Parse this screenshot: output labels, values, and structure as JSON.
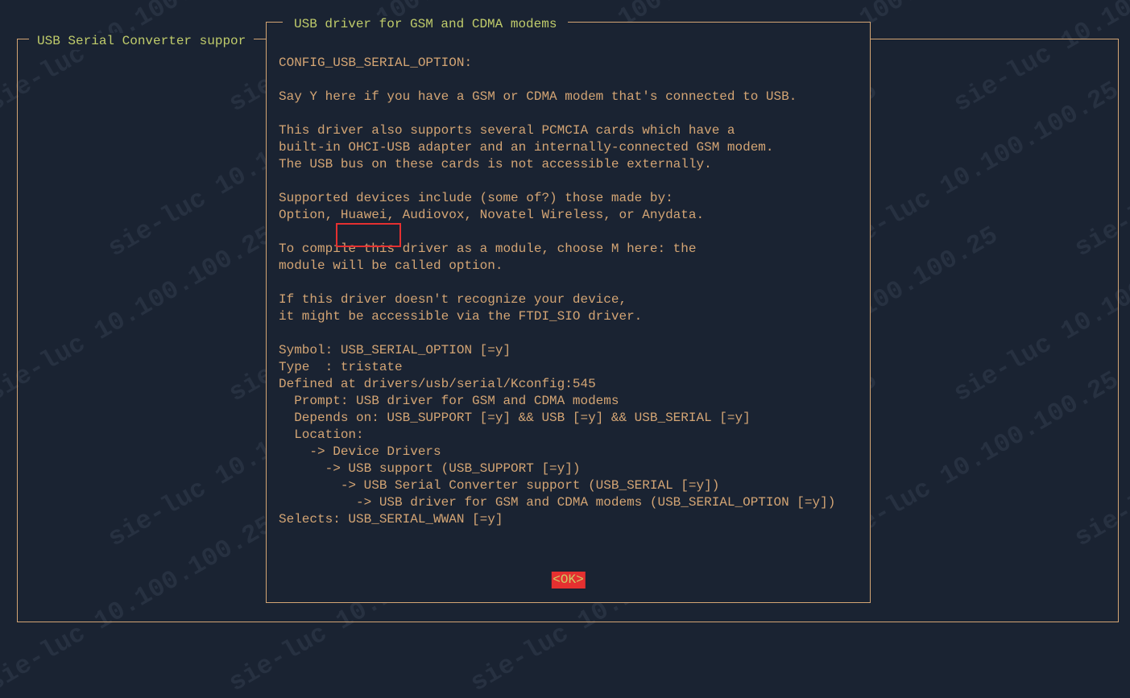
{
  "watermark_text": "sie-luc 10.100.100.25",
  "outer_title": "USB Serial Converter suppor",
  "inner_title": "USB driver for GSM and CDMA modems",
  "help_lines": [
    "CONFIG_USB_SERIAL_OPTION:",
    "",
    "Say Y here if you have a GSM or CDMA modem that's connected to USB.",
    "",
    "This driver also supports several PCMCIA cards which have a",
    "built-in OHCI-USB adapter and an internally-connected GSM modem.",
    "The USB bus on these cards is not accessible externally.",
    "",
    "Supported devices include (some of?) those made by:",
    "Option, Huawei, Audiovox, Novatel Wireless, or Anydata.",
    "",
    "To compile this driver as a module, choose M here: the",
    "module will be called option.",
    "",
    "If this driver doesn't recognize your device,",
    "it might be accessible via the FTDI_SIO driver.",
    "",
    "Symbol: USB_SERIAL_OPTION [=y]",
    "Type  : tristate",
    "Defined at drivers/usb/serial/Kconfig:545",
    "  Prompt: USB driver for GSM and CDMA modems",
    "  Depends on: USB_SUPPORT [=y] && USB [=y] && USB_SERIAL [=y]",
    "  Location:",
    "    -> Device Drivers",
    "      -> USB support (USB_SUPPORT [=y])",
    "        -> USB Serial Converter support (USB_SERIAL [=y])",
    "          -> USB driver for GSM and CDMA modems (USB_SERIAL_OPTION [=y])",
    "Selects: USB_SERIAL_WWAN [=y]"
  ],
  "ok_label": "<OK>",
  "highlighted_word": "Huawei,",
  "colors": {
    "bg": "#1a2332",
    "fg": "#d4a574",
    "title": "#c0cc6b",
    "highlight_border": "#e53030",
    "button_bg": "#e53030",
    "button_fg": "#cccc66"
  }
}
